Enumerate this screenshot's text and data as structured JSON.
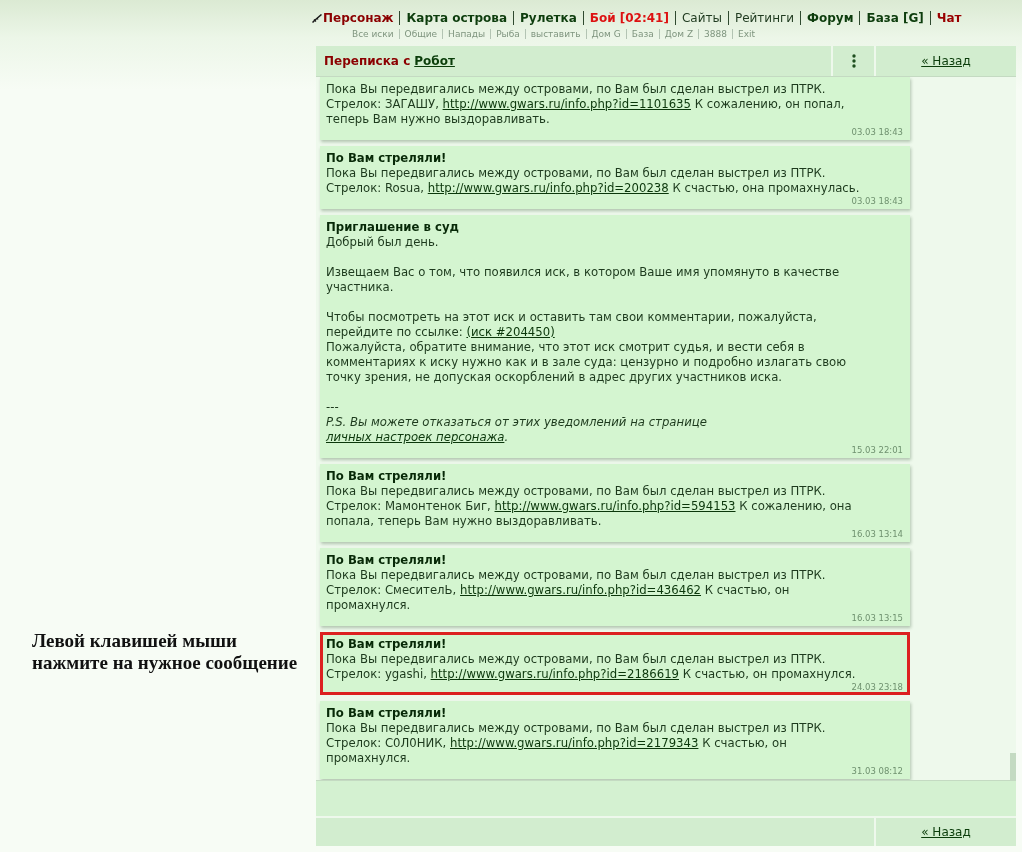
{
  "nav": {
    "primary": [
      {
        "label": "Персонаж",
        "color": "#8b0000",
        "bold": true
      },
      {
        "label": "Карта острова",
        "color": "#0d3d0d",
        "bold": true
      },
      {
        "label": "Рулетка",
        "color": "#0d3d0d",
        "bold": true
      },
      {
        "label": "Бой [02:41]",
        "color": "#dd1111",
        "bold": true
      },
      {
        "label": "Сайты",
        "color": "#1f3a1f",
        "bold": false
      },
      {
        "label": "Рейтинги",
        "color": "#1f3a1f",
        "bold": false
      },
      {
        "label": "Форум",
        "color": "#0d3d0d",
        "bold": true
      },
      {
        "label": "База [G]",
        "color": "#0d3d0d",
        "bold": true
      },
      {
        "label": "Чат",
        "color": "#990000",
        "bold": true
      }
    ],
    "secondary": [
      "Все иски",
      "Общие",
      "Напады",
      "Рыба",
      "выставить",
      "Дом G",
      "База",
      "Дом Z",
      "3888",
      "Exit"
    ]
  },
  "hint": "Левой клавишей мыши нажмите на нужное сообщение",
  "header": {
    "title": "Переписка с",
    "contact": "Робот",
    "back": "« Назад"
  },
  "messages": [
    {
      "selected": false,
      "blocks": [
        {
          "lines": [
            {
              "kind": "plain",
              "parts": [
                {
                  "kind": "text",
                  "text": "Пока Вы передвигались между островами, по Вам был сделан выстрел из ПТРК."
                }
              ]
            },
            {
              "kind": "plain",
              "parts": [
                {
                  "kind": "text",
                  "text": "Стрелок: ЗАГАШУ, "
                },
                {
                  "kind": "link",
                  "text": "http://www.gwars.ru/info.php?id=1101635"
                },
                {
                  "kind": "text",
                  "text": " К сожалению, он попал, теперь Вам нужно выздоравливать."
                }
              ]
            }
          ]
        }
      ],
      "time": "03.03 18:43"
    },
    {
      "selected": false,
      "title": "По Вам стреляли!",
      "blocks": [
        {
          "lines": [
            {
              "kind": "plain",
              "parts": [
                {
                  "kind": "text",
                  "text": "Пока Вы передвигались между островами, по Вам был сделан выстрел из ПТРК."
                }
              ]
            },
            {
              "kind": "plain",
              "parts": [
                {
                  "kind": "text",
                  "text": "Стрелок: Rosua, "
                },
                {
                  "kind": "link",
                  "text": "http://www.gwars.ru/info.php?id=200238"
                },
                {
                  "kind": "text",
                  "text": " К счастью, она промахнулась."
                }
              ]
            }
          ]
        }
      ],
      "time": "03.03 18:43"
    },
    {
      "selected": false,
      "title": "Приглашение в суд",
      "blocks": [
        {
          "lines": [
            {
              "kind": "plain",
              "parts": [
                {
                  "kind": "text",
                  "text": "Добрый был день."
                }
              ]
            }
          ]
        },
        {
          "lines": [
            {
              "kind": "plain",
              "parts": [
                {
                  "kind": "text",
                  "text": "Извещаем Вас о том, что появился иск, в котором Ваше имя упомянуто в качестве участника."
                }
              ]
            }
          ]
        },
        {
          "lines": [
            {
              "kind": "plain",
              "parts": [
                {
                  "kind": "text",
                  "text": "Чтобы посмотреть на этот иск и оставить там свои комментарии, пожалуйста, перейдите по ссылке: "
                },
                {
                  "kind": "link",
                  "text": "(иск #204450)"
                }
              ]
            },
            {
              "kind": "plain",
              "parts": [
                {
                  "kind": "text",
                  "text": "Пожалуйста, обратите внимание, что этот иск смотрит судья, и вести себя в комментариях к иску нужно как и в зале суда: цензурно и подробно излагать свою точку зрения, не допуская оскорблений в адрес других участников иска."
                }
              ]
            }
          ]
        },
        {
          "lines": [
            {
              "kind": "plain",
              "parts": [
                {
                  "kind": "text",
                  "text": "---"
                }
              ]
            },
            {
              "kind": "note",
              "parts": [
                {
                  "kind": "text",
                  "text": "P.S. Вы можете отказаться от этих уведомлений на странице "
                },
                {
                  "kind": "link",
                  "text": "личных настроек персонажа"
                },
                {
                  "kind": "text",
                  "text": "."
                }
              ]
            }
          ]
        }
      ],
      "time": "15.03 22:01"
    },
    {
      "selected": false,
      "title": "По Вам стреляли!",
      "blocks": [
        {
          "lines": [
            {
              "kind": "plain",
              "parts": [
                {
                  "kind": "text",
                  "text": "Пока Вы передвигались между островами, по Вам был сделан выстрел из ПТРК."
                }
              ]
            },
            {
              "kind": "plain",
              "parts": [
                {
                  "kind": "text",
                  "text": "Стрелок: Мамонтенок Биг, "
                },
                {
                  "kind": "link",
                  "text": "http://www.gwars.ru/info.php?id=594153"
                },
                {
                  "kind": "text",
                  "text": " К сожалению, она попала, теперь Вам нужно выздоравливать."
                }
              ]
            }
          ]
        }
      ],
      "time": "16.03 13:14"
    },
    {
      "selected": false,
      "title": "По Вам стреляли!",
      "blocks": [
        {
          "lines": [
            {
              "kind": "plain",
              "parts": [
                {
                  "kind": "text",
                  "text": "Пока Вы передвигались между островами, по Вам был сделан выстрел из ПТРК."
                }
              ]
            },
            {
              "kind": "plain",
              "parts": [
                {
                  "kind": "text",
                  "text": "Стрелок: СмесителЬ, "
                },
                {
                  "kind": "link",
                  "text": "http://www.gwars.ru/info.php?id=436462"
                },
                {
                  "kind": "text",
                  "text": " К счастью, он промахнулся."
                }
              ]
            }
          ]
        }
      ],
      "time": "16.03 13:15"
    },
    {
      "selected": true,
      "title": "По Вам стреляли!",
      "blocks": [
        {
          "lines": [
            {
              "kind": "plain",
              "parts": [
                {
                  "kind": "text",
                  "text": "Пока Вы передвигались между островами, по Вам был сделан выстрел из ПТРК."
                }
              ]
            },
            {
              "kind": "plain",
              "parts": [
                {
                  "kind": "text",
                  "text": "Стрелок: ygashi, "
                },
                {
                  "kind": "link",
                  "text": "http://www.gwars.ru/info.php?id=2186619"
                },
                {
                  "kind": "text",
                  "text": " К счастью, он промахнулся."
                }
              ]
            }
          ]
        }
      ],
      "time": "24.03 23:18"
    },
    {
      "selected": false,
      "title": "По Вам стреляли!",
      "blocks": [
        {
          "lines": [
            {
              "kind": "plain",
              "parts": [
                {
                  "kind": "text",
                  "text": "Пока Вы передвигались между островами, по Вам был сделан выстрел из ПТРК."
                }
              ]
            },
            {
              "kind": "plain",
              "parts": [
                {
                  "kind": "text",
                  "text": "Стрелок: С0Л0НИК, "
                },
                {
                  "kind": "link",
                  "text": "http://www.gwars.ru/info.php?id=2179343"
                },
                {
                  "kind": "text",
                  "text": " К счастью, он промахнулся."
                }
              ]
            }
          ]
        }
      ],
      "time": "31.03 08:12"
    }
  ],
  "footer": {
    "back": "« Назад"
  }
}
